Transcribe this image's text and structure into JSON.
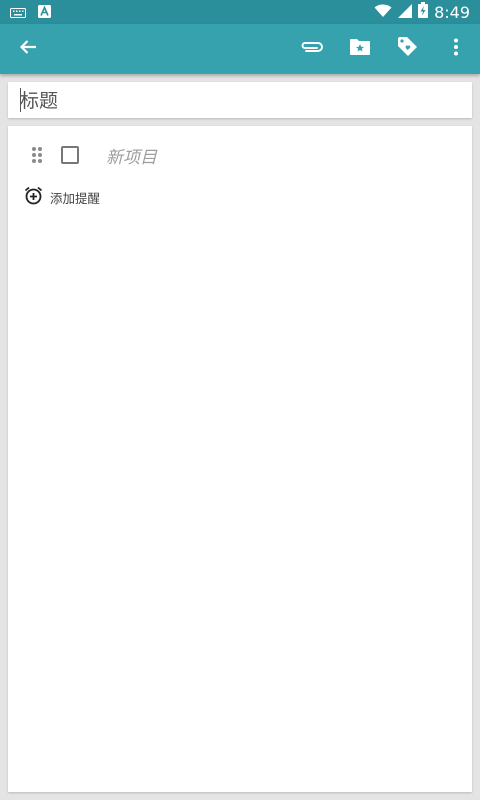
{
  "status_bar": {
    "time": "8:49",
    "icons": [
      "keyboard-icon",
      "a-notification-icon",
      "wifi-icon",
      "signal-icon",
      "battery-charging-icon"
    ]
  },
  "toolbar": {
    "back_icon": "arrow-back-icon",
    "actions": [
      "paperclip-icon",
      "folder-star-icon",
      "tag-icon",
      "more-vert-icon"
    ]
  },
  "note": {
    "title_placeholder": "标题",
    "new_item_placeholder": "新项目",
    "add_reminder_label": "添加提醒"
  },
  "colors": {
    "status_bar": "#2b8f9b",
    "toolbar": "#35a2ae",
    "background": "#e4e4e4"
  }
}
